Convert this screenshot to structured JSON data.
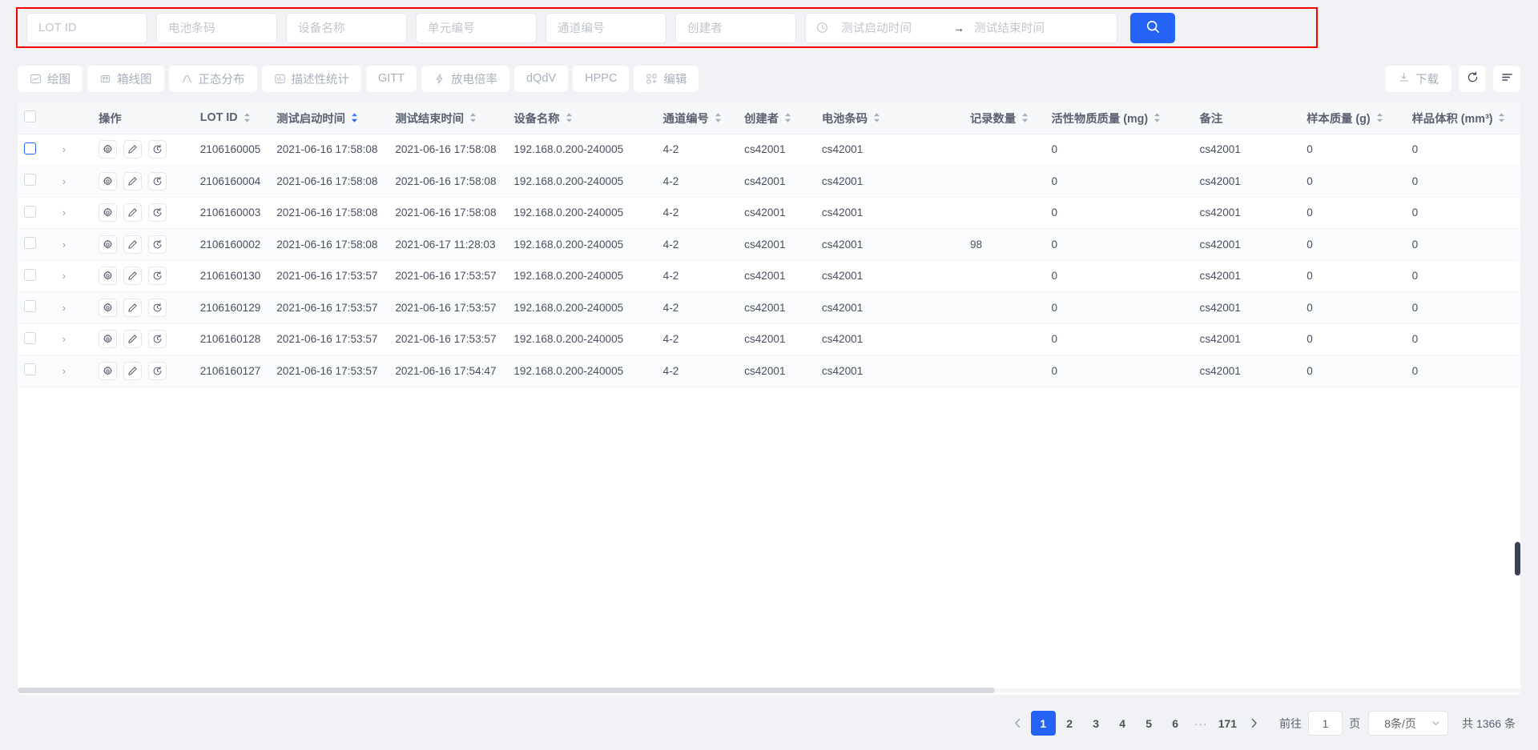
{
  "search": {
    "fields": [
      {
        "name": "lot-id",
        "placeholder": "LOT ID",
        "value": ""
      },
      {
        "name": "battery-barcode",
        "placeholder": "电池条码",
        "value": ""
      },
      {
        "name": "device-name",
        "placeholder": "设备名称",
        "value": ""
      },
      {
        "name": "unit-number",
        "placeholder": "单元编号",
        "value": ""
      },
      {
        "name": "channel-number",
        "placeholder": "通道编号",
        "value": ""
      },
      {
        "name": "creator",
        "placeholder": "创建者",
        "value": ""
      }
    ],
    "date_range": {
      "start_placeholder": "测试启动时间",
      "end_placeholder": "测试结束时间",
      "separator": "→",
      "icon": "clock-icon"
    },
    "search_button_icon": "search-icon",
    "highlight_color": "#fc0000",
    "accent_color": "#2563f6"
  },
  "toolbar": {
    "buttons": [
      {
        "label": "绘图",
        "icon": "line-chart-icon"
      },
      {
        "label": "箱线图",
        "icon": "boxplot-icon"
      },
      {
        "label": "正态分布",
        "icon": "normal-distribution-icon"
      },
      {
        "label": "描述性统计",
        "icon": "bar-chart-icon"
      },
      {
        "label": "GITT",
        "icon": ""
      },
      {
        "label": "放电倍率",
        "icon": "lightning-icon"
      },
      {
        "label": "dQdV",
        "icon": ""
      },
      {
        "label": "HPPC",
        "icon": ""
      },
      {
        "label": "编辑",
        "icon": "edit-grid-icon"
      }
    ],
    "download_label": "下载",
    "download_icon": "download-icon",
    "refresh_icon": "refresh-icon",
    "menu_icon": "menu-icon"
  },
  "table": {
    "columns": [
      {
        "key": "checkbox",
        "label": "",
        "sortable": false
      },
      {
        "key": "expand",
        "label": "",
        "sortable": false
      },
      {
        "key": "actions",
        "label": "操作",
        "sortable": false
      },
      {
        "key": "lot_id",
        "label": "LOT ID",
        "sortable": true,
        "sort_state": "none"
      },
      {
        "key": "start_time",
        "label": "测试启动时间",
        "sortable": true,
        "sort_state": "desc"
      },
      {
        "key": "end_time",
        "label": "测试结束时间",
        "sortable": true,
        "sort_state": "none"
      },
      {
        "key": "device_name",
        "label": "设备名称",
        "sortable": true,
        "sort_state": "none"
      },
      {
        "key": "channel_no",
        "label": "通道编号",
        "sortable": true,
        "sort_state": "none"
      },
      {
        "key": "creator",
        "label": "创建者",
        "sortable": true,
        "sort_state": "none"
      },
      {
        "key": "battery_barcode",
        "label": "电池条码",
        "sortable": true,
        "sort_state": "none"
      },
      {
        "key": "record_count",
        "label": "记录数量",
        "sortable": true,
        "sort_state": "none"
      },
      {
        "key": "active_mass",
        "label": "活性物质质量 (mg)",
        "sortable": true,
        "sort_state": "none"
      },
      {
        "key": "note",
        "label": "备注",
        "sortable": false
      },
      {
        "key": "sample_weight",
        "label": "样本质量 (g)",
        "sortable": true,
        "sort_state": "none"
      },
      {
        "key": "sample_volume",
        "label": "样品体积 (mm³)",
        "sortable": true,
        "sort_state": "none"
      }
    ],
    "row_action_icons": [
      "gear-icon",
      "pencil-icon",
      "history-icon"
    ],
    "rows": [
      {
        "lot_id": "2106160005",
        "start_time": "2021-06-16 17:58:08",
        "end_time": "2021-06-16 17:58:08",
        "device_name": "192.168.0.200-240005",
        "channel_no": "4-2",
        "creator": "cs42001",
        "battery_barcode": "cs42001",
        "record_count": "",
        "active_mass": "0",
        "note": "cs42001",
        "sample_weight": "0",
        "sample_volume": "0",
        "checkbox_focus": true
      },
      {
        "lot_id": "2106160004",
        "start_time": "2021-06-16 17:58:08",
        "end_time": "2021-06-16 17:58:08",
        "device_name": "192.168.0.200-240005",
        "channel_no": "4-2",
        "creator": "cs42001",
        "battery_barcode": "cs42001",
        "record_count": "",
        "active_mass": "0",
        "note": "cs42001",
        "sample_weight": "0",
        "sample_volume": "0",
        "checkbox_focus": false
      },
      {
        "lot_id": "2106160003",
        "start_time": "2021-06-16 17:58:08",
        "end_time": "2021-06-16 17:58:08",
        "device_name": "192.168.0.200-240005",
        "channel_no": "4-2",
        "creator": "cs42001",
        "battery_barcode": "cs42001",
        "record_count": "",
        "active_mass": "0",
        "note": "cs42001",
        "sample_weight": "0",
        "sample_volume": "0",
        "checkbox_focus": false
      },
      {
        "lot_id": "2106160002",
        "start_time": "2021-06-16 17:58:08",
        "end_time": "2021-06-17 11:28:03",
        "device_name": "192.168.0.200-240005",
        "channel_no": "4-2",
        "creator": "cs42001",
        "battery_barcode": "cs42001",
        "record_count": "98",
        "active_mass": "0",
        "note": "cs42001",
        "sample_weight": "0",
        "sample_volume": "0",
        "checkbox_focus": false
      },
      {
        "lot_id": "2106160130",
        "start_time": "2021-06-16 17:53:57",
        "end_time": "2021-06-16 17:53:57",
        "device_name": "192.168.0.200-240005",
        "channel_no": "4-2",
        "creator": "cs42001",
        "battery_barcode": "cs42001",
        "record_count": "",
        "active_mass": "0",
        "note": "cs42001",
        "sample_weight": "0",
        "sample_volume": "0",
        "checkbox_focus": false
      },
      {
        "lot_id": "2106160129",
        "start_time": "2021-06-16 17:53:57",
        "end_time": "2021-06-16 17:53:57",
        "device_name": "192.168.0.200-240005",
        "channel_no": "4-2",
        "creator": "cs42001",
        "battery_barcode": "cs42001",
        "record_count": "",
        "active_mass": "0",
        "note": "cs42001",
        "sample_weight": "0",
        "sample_volume": "0",
        "checkbox_focus": false
      },
      {
        "lot_id": "2106160128",
        "start_time": "2021-06-16 17:53:57",
        "end_time": "2021-06-16 17:53:57",
        "device_name": "192.168.0.200-240005",
        "channel_no": "4-2",
        "creator": "cs42001",
        "battery_barcode": "cs42001",
        "record_count": "",
        "active_mass": "0",
        "note": "cs42001",
        "sample_weight": "0",
        "sample_volume": "0",
        "checkbox_focus": false
      },
      {
        "lot_id": "2106160127",
        "start_time": "2021-06-16 17:53:57",
        "end_time": "2021-06-16 17:54:47",
        "device_name": "192.168.0.200-240005",
        "channel_no": "4-2",
        "creator": "cs42001",
        "battery_barcode": "cs42001",
        "record_count": "",
        "active_mass": "0",
        "note": "cs42001",
        "sample_weight": "0",
        "sample_volume": "0",
        "checkbox_focus": false
      }
    ]
  },
  "pagination": {
    "prev_icon": "chevron-left-icon",
    "next_icon": "chevron-right-icon",
    "pages": [
      "1",
      "2",
      "3",
      "4",
      "5",
      "6"
    ],
    "ellipsis": "···",
    "last_page": "171",
    "current_page": "1",
    "goto_label": "前往",
    "goto_value": "1",
    "goto_unit": "页",
    "page_size": "8条/页",
    "total_label": "共 1366 条"
  }
}
